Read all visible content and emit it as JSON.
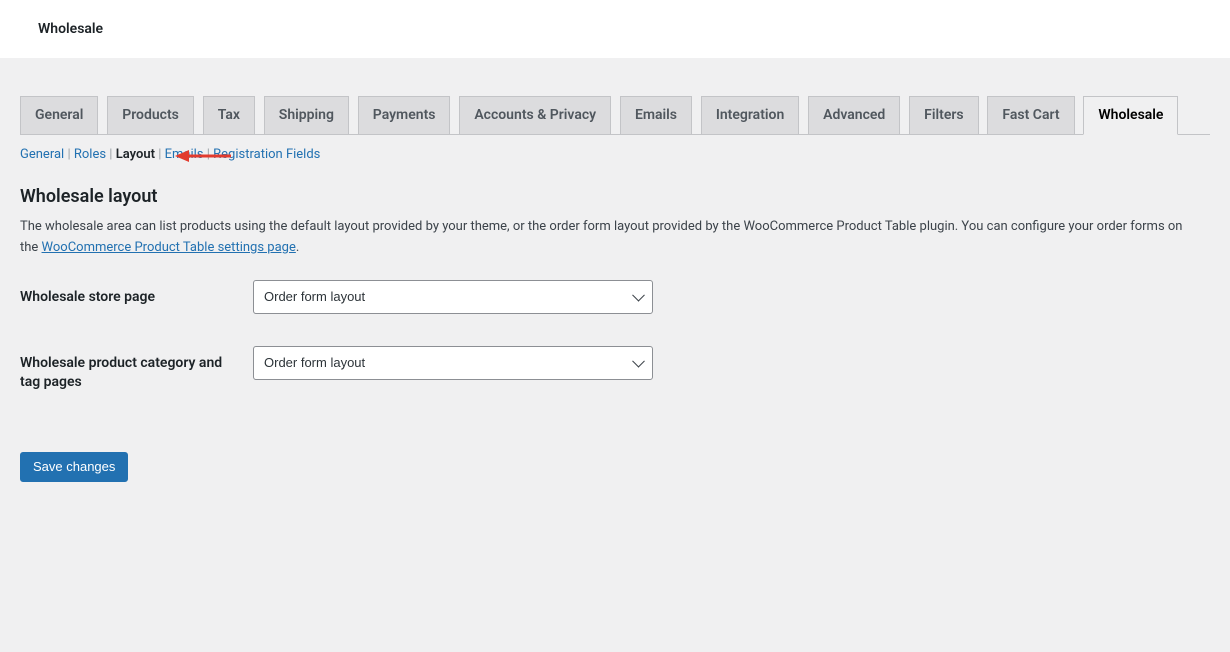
{
  "topbar": {
    "title": "Wholesale"
  },
  "tabs": {
    "items": [
      {
        "label": "General"
      },
      {
        "label": "Products"
      },
      {
        "label": "Tax"
      },
      {
        "label": "Shipping"
      },
      {
        "label": "Payments"
      },
      {
        "label": "Accounts & Privacy"
      },
      {
        "label": "Emails"
      },
      {
        "label": "Integration"
      },
      {
        "label": "Advanced"
      },
      {
        "label": "Filters"
      },
      {
        "label": "Fast Cart"
      },
      {
        "label": "Wholesale"
      }
    ],
    "active_index": 11
  },
  "subsub": {
    "items": [
      {
        "label": "General"
      },
      {
        "label": "Roles"
      },
      {
        "label": "Layout"
      },
      {
        "label": "Emails"
      },
      {
        "label": "Registration Fields"
      }
    ],
    "current_index": 2,
    "separator": " | "
  },
  "section": {
    "title": "Wholesale layout",
    "desc_prefix": "The wholesale area can list products using the default layout provided by your theme, or the order form layout provided by the WooCommerce Product Table plugin. You can configure your order forms on the ",
    "desc_link_text": "WooCommerce Product Table settings page",
    "desc_suffix": "."
  },
  "fields": {
    "store_page": {
      "label": "Wholesale store page",
      "value": "Order form layout"
    },
    "category_tag_pages": {
      "label": "Wholesale product category and tag pages",
      "value": "Order form layout"
    }
  },
  "buttons": {
    "save": "Save changes"
  },
  "colors": {
    "accent": "#2271b1",
    "arrow": "#e23b2e"
  }
}
